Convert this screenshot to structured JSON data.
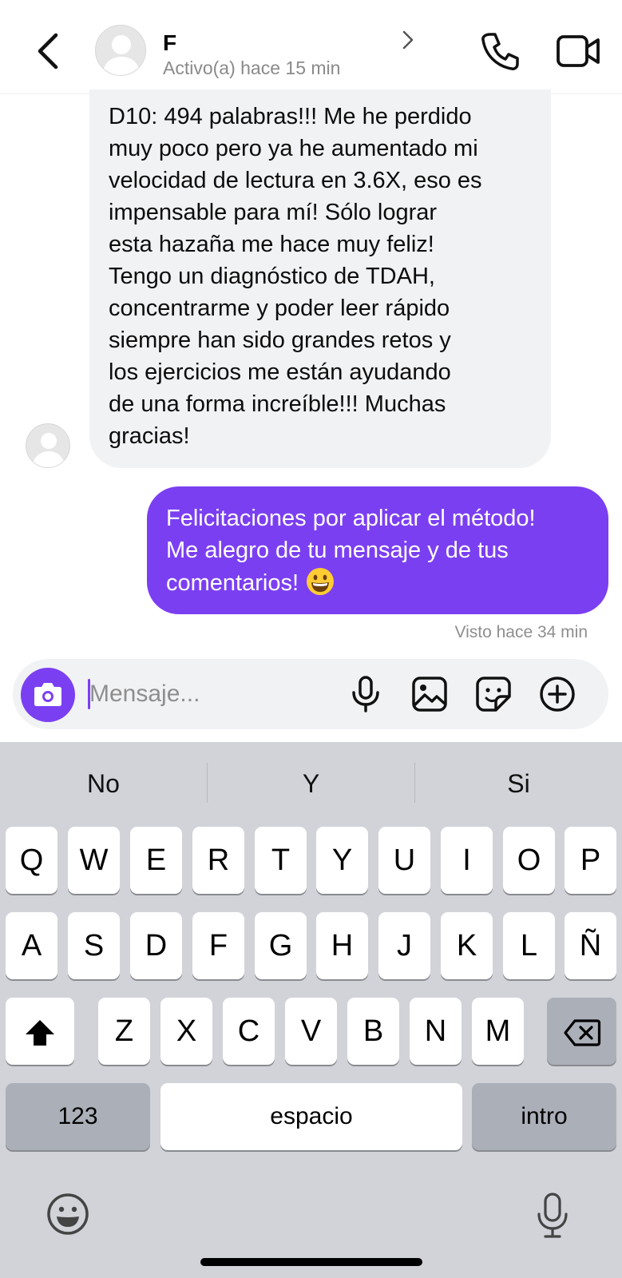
{
  "header": {
    "contact_name": "F",
    "status": "Activo(a) hace 15 min",
    "icons": [
      "back-chevron-icon",
      "avatar-placeholder",
      "chevron-right-icon",
      "phone-icon",
      "video-camera-icon"
    ]
  },
  "messages": {
    "incoming": "D10: 494 palabras!!! Me he perdido\nmuy poco pero ya he aumentado mi\nvelocidad de lectura en 3.6X, eso es\nimpensable para mí! Sólo lograr\nesta hazaña me hace muy feliz!\nTengo un diagnóstico de TDAH,\nconcentrarme y poder leer rápido\nsiempre han sido grandes retos y\nlos ejercicios me están ayudando\nde una forma increíble!!! Muchas\ngracias!",
    "outgoing": "Felicitaciones por aplicar el método!\nMe alegro de tu mensaje y de tus\ncomentarios! ",
    "outgoing_emoji": "grinning-face-emoji",
    "seen": "Visto hace 34 min"
  },
  "composer": {
    "placeholder": "Mensaje...",
    "icons": [
      "camera-icon",
      "microphone-icon",
      "gallery-icon",
      "sticker-icon",
      "plus-circle-icon"
    ]
  },
  "keyboard": {
    "suggestions": [
      "No",
      "Y",
      "Si"
    ],
    "row1": [
      "Q",
      "W",
      "E",
      "R",
      "T",
      "Y",
      "U",
      "I",
      "O",
      "P"
    ],
    "row2": [
      "A",
      "S",
      "D",
      "F",
      "G",
      "H",
      "J",
      "K",
      "L",
      "Ñ"
    ],
    "row3": [
      "Z",
      "X",
      "C",
      "V",
      "B",
      "N",
      "M"
    ],
    "numbers_label": "123",
    "space_label": "espacio",
    "return_label": "intro",
    "icons": [
      "shift-icon",
      "backspace-icon",
      "emoji-icon",
      "dictation-mic-icon"
    ]
  },
  "colors": {
    "accent": "#7b3ff2",
    "incoming_bubble": "#f1f2f4",
    "keyboard_bg": "#d1d3d9"
  }
}
